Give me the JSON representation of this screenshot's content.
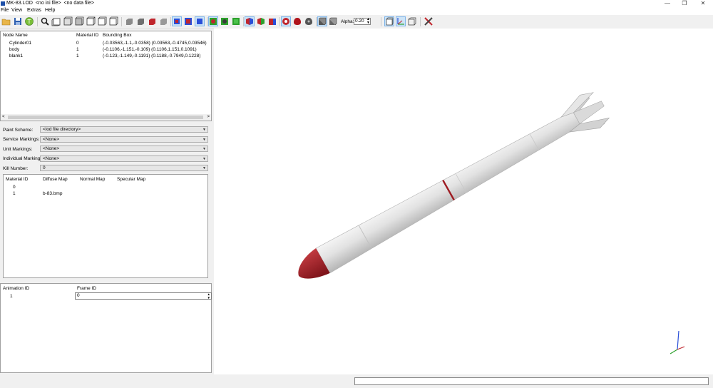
{
  "window": {
    "title": "MK-83.LOD  <no ini file>  <no data file>",
    "minimize": "—",
    "restore": "❐",
    "close": "✕"
  },
  "menu": [
    "File",
    "View",
    "Extras",
    "Help"
  ],
  "toolbar": {
    "alpha_label": "Alpha:",
    "alpha_value": "0.20"
  },
  "node_table": {
    "headers": [
      "Node Name",
      "Material ID",
      "Bounding Box"
    ],
    "rows": [
      [
        "Cylinder01",
        "0",
        "(-0.03563,-1.1,-0.0358) (0.03563,-0.4745,0.03546)"
      ],
      [
        "body",
        "1",
        "(-0.1106,-1.151,-0.109) (0.1106,1.151,0.1091)"
      ],
      [
        "blank1",
        "1",
        "(-0.123,-1.149,-0.1191) (0.1188,-0.7949,0.1228)"
      ]
    ]
  },
  "settings": {
    "paint_scheme_label": "Paint Scheme:",
    "paint_scheme_value": "<lod file directory>",
    "service_markings_label": "Service Markings:",
    "service_markings_value": "<None>",
    "unit_markings_label": "Unit Markings:",
    "unit_markings_value": "<None>",
    "individual_markings_label": "Individual Markings:",
    "individual_markings_value": "<None>",
    "kill_number_label": "Kill Number:",
    "kill_number_value": "0"
  },
  "material_table": {
    "headers": [
      "Material ID",
      "Diffuse Map",
      "Normal Map",
      "Specular Map"
    ],
    "rows": [
      [
        "0",
        "",
        "",
        ""
      ],
      [
        "1",
        "b-83.bmp",
        "",
        ""
      ]
    ]
  },
  "animation_table": {
    "headers": [
      "Animation ID",
      "Frame ID"
    ],
    "row_id": "1",
    "frame_value": "0"
  },
  "colors": {
    "missile_body": "#dcdcdc",
    "missile_nose": "#9e1b22",
    "pressed_button": "#cde4f7"
  }
}
